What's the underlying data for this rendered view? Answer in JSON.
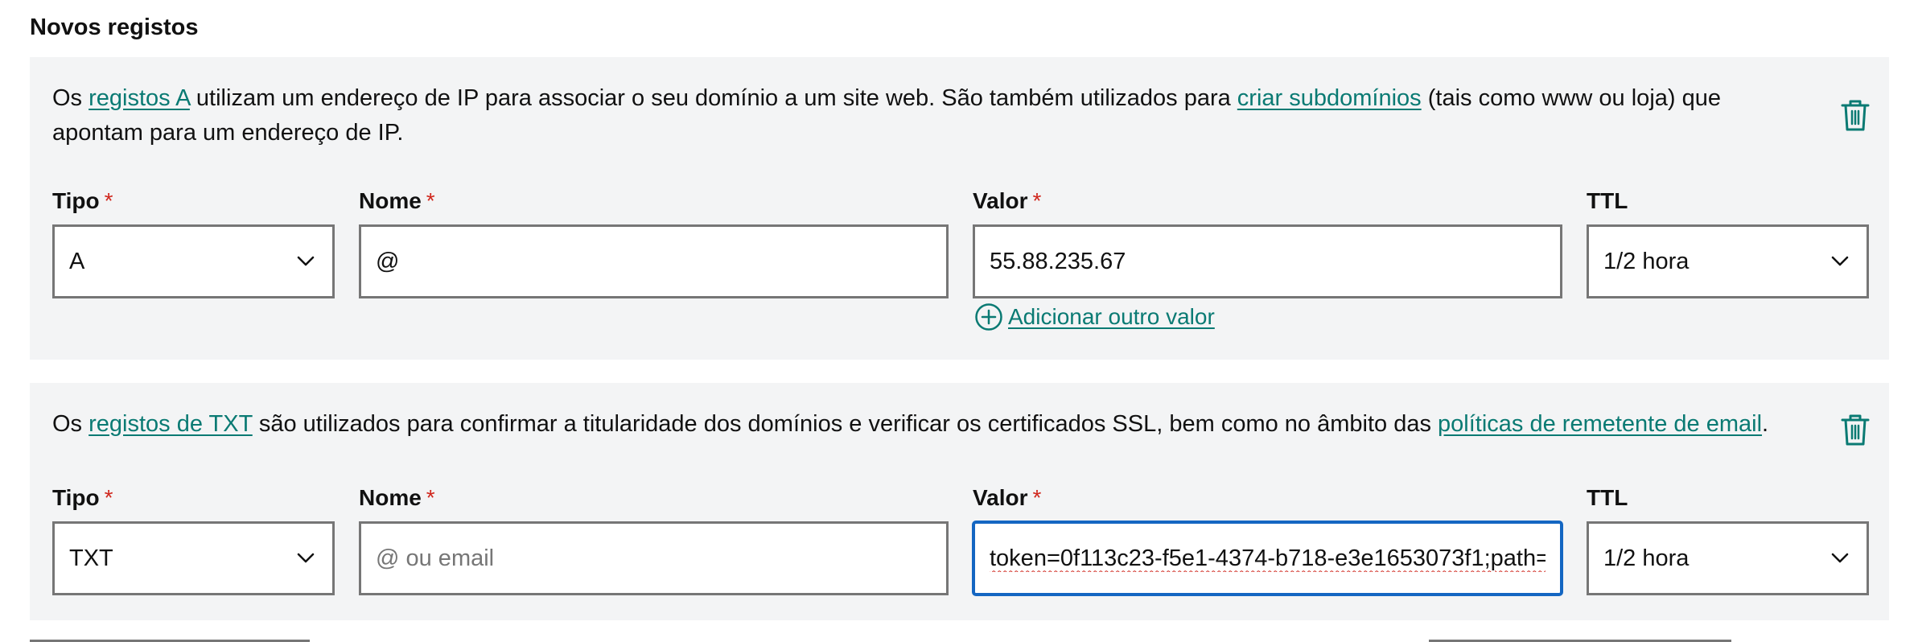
{
  "section_title": "Novos registos",
  "colors": {
    "card_bg": "#f3f4f5",
    "link": "#0a7a73",
    "required": "#d0271d",
    "focus_border": "#1466c2"
  },
  "records": [
    {
      "desc_before": "Os ",
      "desc_link1": "registos A",
      "desc_middle": " utilizam um endereço de IP para associar o seu domínio a um site web. São também utilizados para ",
      "desc_link2": "criar subdomínios",
      "desc_after": " (tais como www ou loja) que apontam para um endereço de IP.",
      "tipo_label": "Tipo",
      "tipo_value": "A",
      "nome_label": "Nome",
      "nome_value": "@",
      "nome_placeholder": "",
      "valor_label": "Valor",
      "valor_value": "55.88.235.67",
      "ttl_label": "TTL",
      "ttl_value": "1/2 hora",
      "add_value_label": "Adicionar outro valor",
      "required_mark": "*"
    },
    {
      "desc_before": "Os ",
      "desc_link1": "registos de TXT",
      "desc_middle": " são utilizados para confirmar a titularidade dos domínios e verificar os certificados SSL, bem como no âmbito das ",
      "desc_link2": "políticas de remetente de email",
      "desc_after": ".",
      "tipo_label": "Tipo",
      "tipo_value": "TXT",
      "nome_label": "Nome",
      "nome_value": "",
      "nome_placeholder": "@ ou email",
      "valor_label": "Valor",
      "valor_value": "token=0f113c23-f5e1-4374-b718-e3e1653073f1;path=",
      "ttl_label": "TTL",
      "ttl_value": "1/2 hora",
      "required_mark": "*"
    }
  ],
  "icons": {
    "delete": "trash-icon",
    "chevron": "chevron-down-icon",
    "add": "plus-circle-icon"
  }
}
